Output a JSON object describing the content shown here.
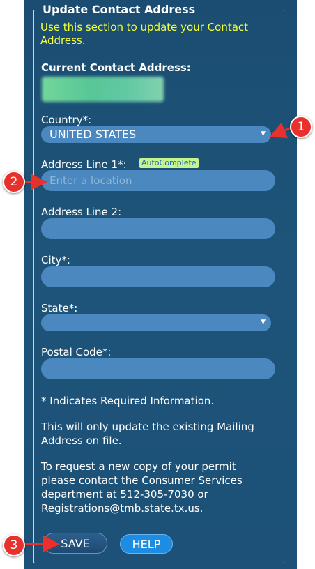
{
  "section": {
    "legend": "Update Contact Address",
    "intro": "Use this section to update your Contact Address."
  },
  "current_address": {
    "label": "Current Contact Address:"
  },
  "fields": {
    "country_label": "Country*:",
    "country_value": "UNITED STATES",
    "address1_label": "Address Line 1*:",
    "autocomplete_badge": "AutoComplete",
    "address1_placeholder": "Enter a location",
    "address2_label": "Address Line 2:",
    "city_label": "City*:",
    "state_label": "State*:",
    "state_value": "",
    "postal_label": "Postal Code*:"
  },
  "notes": {
    "required": "* Indicates Required Information.",
    "mailing": "This will only update the existing Mailing Address on file.",
    "permit": "To request a new copy of your permit please contact the Consumer Services department at 512-305-7030 or Registrations@tmb.state.tx.us."
  },
  "buttons": {
    "save": "SAVE",
    "help": "HELP"
  },
  "callouts": [
    "1",
    "2",
    "3"
  ],
  "colors": {
    "panel": "#1b4d72",
    "field": "#4a88bf",
    "intro_text": "#f5ff3a",
    "callout": "#e8302c",
    "help_button": "#1d8ce3"
  }
}
